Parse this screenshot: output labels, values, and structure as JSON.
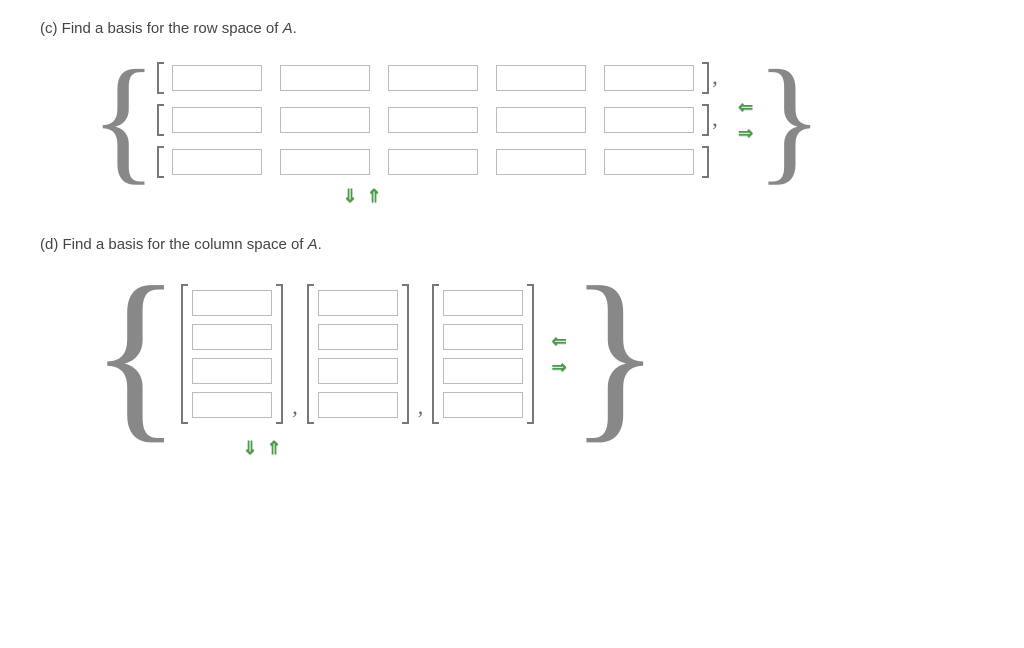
{
  "partC": {
    "label": "(c)",
    "prompt_pre": "Find a basis for the row space of ",
    "matrix_var": "A",
    "prompt_post": ".",
    "rows": 3,
    "cols": 5,
    "arrows": {
      "left": "⇐",
      "right": "⇒",
      "down": "⇓",
      "up": "⇑"
    }
  },
  "partD": {
    "label": "(d)",
    "prompt_pre": "Find a basis for the column space of ",
    "matrix_var": "A",
    "prompt_post": ".",
    "vectors": 3,
    "rows": 4,
    "arrows": {
      "left": "⇐",
      "right": "⇒",
      "down": "⇓",
      "up": "⇑"
    }
  }
}
